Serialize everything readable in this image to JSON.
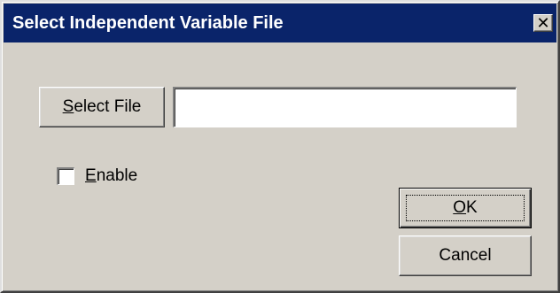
{
  "window": {
    "title": "Select Independent Variable File",
    "close_glyph": "✕"
  },
  "select_file": {
    "mnemonic": "S",
    "label_rest": "elect File"
  },
  "file_path": {
    "value": "",
    "placeholder": ""
  },
  "enable": {
    "mnemonic": "E",
    "label_rest": "nable",
    "checked": false
  },
  "buttons": {
    "ok_mnemonic": "O",
    "ok_rest": "K",
    "cancel_label": "Cancel"
  },
  "colors": {
    "titlebar": "#0a246a",
    "face": "#d4d0c8"
  }
}
